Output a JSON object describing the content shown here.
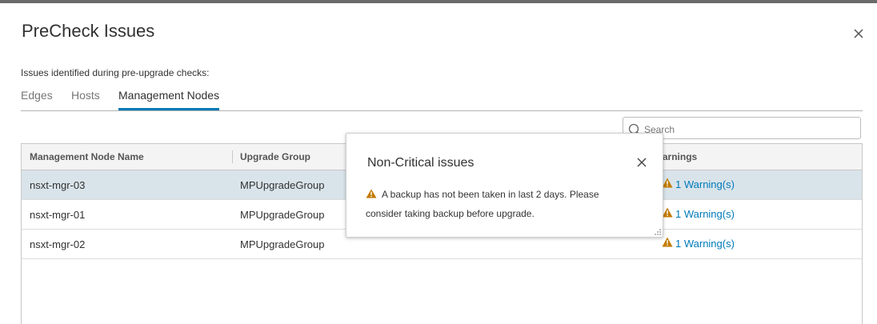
{
  "dialog": {
    "title": "PreCheck Issues",
    "subtitle": "Issues identified during pre-upgrade checks:",
    "tabs": [
      {
        "label": "Edges",
        "active": false
      },
      {
        "label": "Hosts",
        "active": false
      },
      {
        "label": "Management Nodes",
        "active": true
      }
    ],
    "search": {
      "placeholder": "Search",
      "value": ""
    },
    "grid": {
      "columns": [
        "Management Node Name",
        "Upgrade Group",
        "Warnings"
      ],
      "rows": [
        {
          "name": "nsxt-mgr-03",
          "group": "MPUpgradeGroup",
          "warnings": "1 Warning(s)",
          "selected": true
        },
        {
          "name": "nsxt-mgr-01",
          "group": "MPUpgradeGroup",
          "warnings": "1 Warning(s)",
          "selected": false
        },
        {
          "name": "nsxt-mgr-02",
          "group": "MPUpgradeGroup",
          "warnings": "1 Warning(s)",
          "selected": false
        }
      ]
    }
  },
  "popover": {
    "title": "Non-Critical issues",
    "message": "A backup has not been taken in last 2 days. Please consider taking backup before upgrade."
  },
  "colors": {
    "accent": "#0079b8",
    "warning": "#c27b00",
    "selected_row": "#d9e4ea"
  },
  "icons": [
    "close-icon",
    "search-icon",
    "warning-icon",
    "resize-handle-icon"
  ]
}
